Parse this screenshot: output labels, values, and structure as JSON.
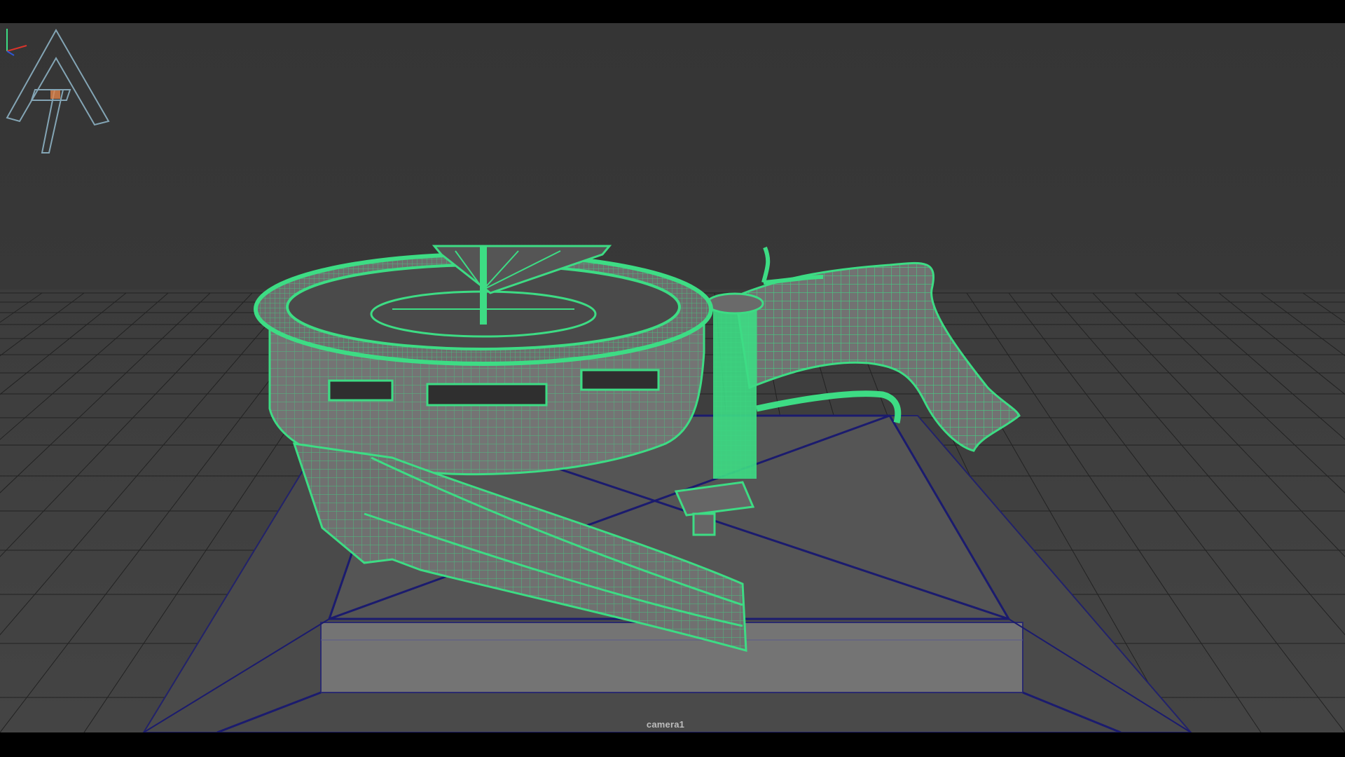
{
  "viewport": {
    "camera_label": "camera1",
    "background_color": "#383838",
    "grid_color": "#1e1e1e",
    "wireframe_color": "#3ddc84",
    "selection_edge_color": "#1b1b6e",
    "surface_color": "#707070"
  },
  "icons": {
    "axis": "axis-gizmo-icon",
    "logo": "studio-logo-icon"
  }
}
